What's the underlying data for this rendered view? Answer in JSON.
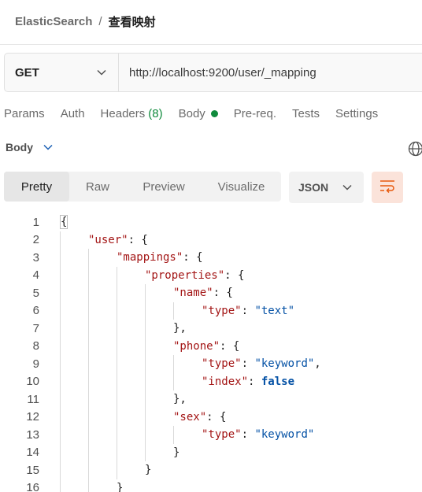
{
  "breadcrumb": {
    "parent": "ElasticSearch",
    "separator": "/",
    "current": "查看映射"
  },
  "request": {
    "method": "GET",
    "url": "http://localhost:9200/user/_mapping"
  },
  "request_tabs": {
    "params": "Params",
    "auth": "Auth",
    "headers": "Headers",
    "headers_count": "(8)",
    "body": "Body",
    "prereq": "Pre-req.",
    "tests": "Tests",
    "settings": "Settings"
  },
  "response": {
    "section_label": "Body",
    "view_tabs": [
      "Pretty",
      "Raw",
      "Preview",
      "Visualize"
    ],
    "active_view": "Pretty",
    "format": "JSON"
  },
  "colors": {
    "accent": "#e8590c",
    "key": "#a31515",
    "string": "#0451a5",
    "status_dot": "#0f8a3c"
  },
  "icons": {
    "method_dropdown": "chevron-down-icon",
    "body_dropdown": "chevron-down-icon",
    "format_dropdown": "chevron-down-icon",
    "globe": "globe-icon",
    "wrap": "wrap-lines-icon"
  },
  "code": {
    "line_numbers": [
      "1",
      "2",
      "3",
      "4",
      "5",
      "6",
      "7",
      "8",
      "9",
      "10",
      "11",
      "12",
      "13",
      "14",
      "15",
      "16"
    ],
    "lines": [
      {
        "indent": 0,
        "tokens": [
          {
            "t": "p",
            "v": "{"
          }
        ]
      },
      {
        "indent": 1,
        "tokens": [
          {
            "t": "k",
            "v": "\"user\""
          },
          {
            "t": "p",
            "v": ": {"
          }
        ]
      },
      {
        "indent": 2,
        "tokens": [
          {
            "t": "k",
            "v": "\"mappings\""
          },
          {
            "t": "p",
            "v": ": {"
          }
        ]
      },
      {
        "indent": 3,
        "tokens": [
          {
            "t": "k",
            "v": "\"properties\""
          },
          {
            "t": "p",
            "v": ": {"
          }
        ]
      },
      {
        "indent": 4,
        "tokens": [
          {
            "t": "k",
            "v": "\"name\""
          },
          {
            "t": "p",
            "v": ": {"
          }
        ]
      },
      {
        "indent": 5,
        "tokens": [
          {
            "t": "k",
            "v": "\"type\""
          },
          {
            "t": "p",
            "v": ": "
          },
          {
            "t": "s",
            "v": "\"text\""
          }
        ]
      },
      {
        "indent": 4,
        "tokens": [
          {
            "t": "p",
            "v": "},"
          }
        ]
      },
      {
        "indent": 4,
        "tokens": [
          {
            "t": "k",
            "v": "\"phone\""
          },
          {
            "t": "p",
            "v": ": {"
          }
        ]
      },
      {
        "indent": 5,
        "tokens": [
          {
            "t": "k",
            "v": "\"type\""
          },
          {
            "t": "p",
            "v": ": "
          },
          {
            "t": "s",
            "v": "\"keyword\""
          },
          {
            "t": "p",
            "v": ","
          }
        ]
      },
      {
        "indent": 5,
        "tokens": [
          {
            "t": "k",
            "v": "\"index\""
          },
          {
            "t": "p",
            "v": ": "
          },
          {
            "t": "b",
            "v": "false"
          }
        ]
      },
      {
        "indent": 4,
        "tokens": [
          {
            "t": "p",
            "v": "},"
          }
        ]
      },
      {
        "indent": 4,
        "tokens": [
          {
            "t": "k",
            "v": "\"sex\""
          },
          {
            "t": "p",
            "v": ": {"
          }
        ]
      },
      {
        "indent": 5,
        "tokens": [
          {
            "t": "k",
            "v": "\"type\""
          },
          {
            "t": "p",
            "v": ": "
          },
          {
            "t": "s",
            "v": "\"keyword\""
          }
        ]
      },
      {
        "indent": 4,
        "tokens": [
          {
            "t": "p",
            "v": "}"
          }
        ]
      },
      {
        "indent": 3,
        "tokens": [
          {
            "t": "p",
            "v": "}"
          }
        ]
      },
      {
        "indent": 2,
        "tokens": [
          {
            "t": "p",
            "v": "}"
          }
        ]
      }
    ]
  }
}
